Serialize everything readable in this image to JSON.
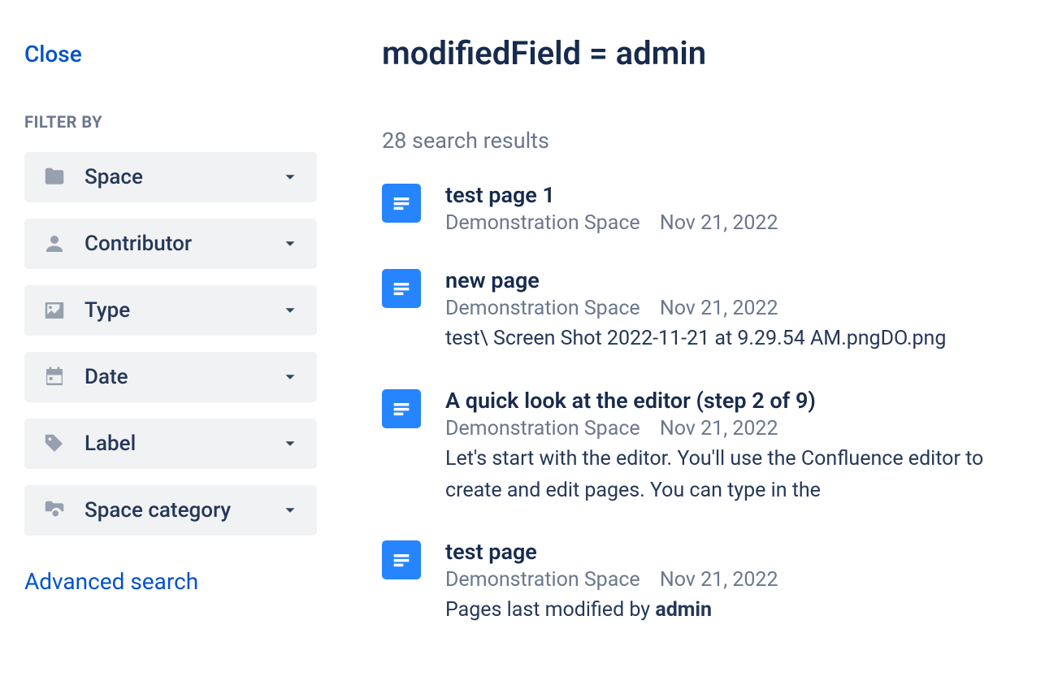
{
  "sidebar": {
    "close_label": "Close",
    "filter_heading": "FILTER BY",
    "filters": [
      {
        "icon": "folder",
        "label": "Space"
      },
      {
        "icon": "person",
        "label": "Contributor"
      },
      {
        "icon": "image",
        "label": "Type"
      },
      {
        "icon": "calendar",
        "label": "Date"
      },
      {
        "icon": "tag",
        "label": "Label"
      },
      {
        "icon": "folder-cog",
        "label": "Space category"
      }
    ],
    "advanced_label": "Advanced search"
  },
  "main": {
    "query": "modifiedField = admin",
    "result_count": "28 search results",
    "results": [
      {
        "title": "test page 1",
        "space": "Demonstration Space",
        "date": "Nov 21, 2022",
        "snippet": ""
      },
      {
        "title": "new page",
        "space": "Demonstration Space",
        "date": "Nov 21, 2022",
        "snippet": "test\\ Screen Shot 2022-11-21 at 9.29.54 AM.pngDO.png"
      },
      {
        "title": "A quick look at the editor (step 2 of 9)",
        "space": "Demonstration Space",
        "date": "Nov 21, 2022",
        "snippet": "Let's start with the editor. You'll use the Confluence editor to create and edit pages. You can type in the"
      },
      {
        "title": "test page",
        "space": "Demonstration Space",
        "date": "Nov 21, 2022",
        "snippet_prefix": "Pages last modified by ",
        "snippet_bold": "admin"
      }
    ]
  }
}
